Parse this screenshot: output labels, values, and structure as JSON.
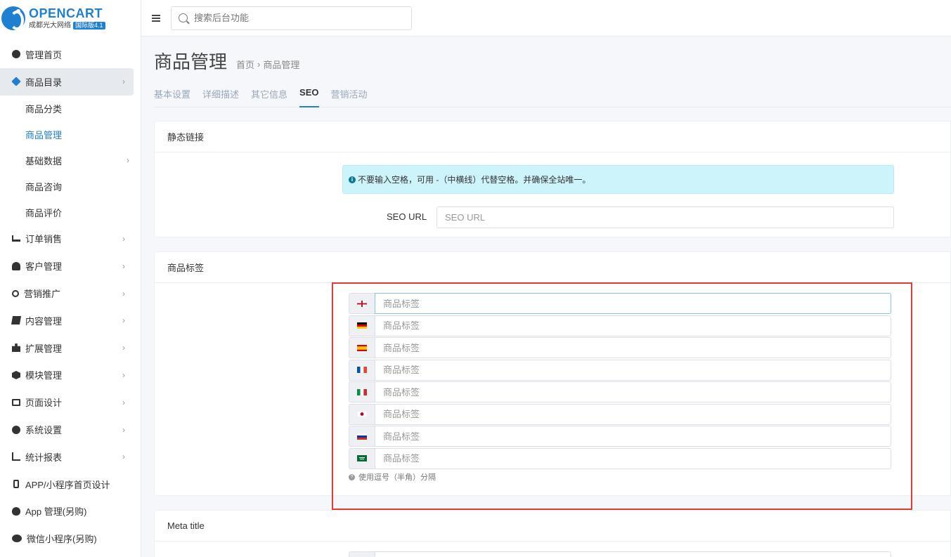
{
  "brand": {
    "title": "OPENCART",
    "subtitle": "成都光大网络",
    "badge": "国际版4.1"
  },
  "search": {
    "placeholder": "搜索后台功能"
  },
  "sidebar": {
    "items": [
      {
        "label": "管理首页",
        "icon": "dashboard-icon"
      },
      {
        "label": "商品目录",
        "icon": "tags-icon",
        "active": true
      },
      {
        "label": "订单销售",
        "icon": "cart-icon"
      },
      {
        "label": "客户管理",
        "icon": "user-icon"
      },
      {
        "label": "营销推广",
        "icon": "share-icon"
      },
      {
        "label": "内容管理",
        "icon": "book-icon"
      },
      {
        "label": "扩展管理",
        "icon": "puzzle-icon"
      },
      {
        "label": "模块管理",
        "icon": "cube-icon"
      },
      {
        "label": "页面设计",
        "icon": "monitor-icon"
      },
      {
        "label": "系统设置",
        "icon": "gear-icon"
      },
      {
        "label": "统计报表",
        "icon": "bar-chart-icon"
      },
      {
        "label": "APP/小程序首页设计",
        "icon": "mobile-icon"
      },
      {
        "label": "App 管理(另购)",
        "icon": "apple-icon"
      },
      {
        "label": "微信小程序(另购)",
        "icon": "wechat-icon"
      }
    ],
    "catalog_sub": [
      {
        "label": "商品分类"
      },
      {
        "label": "商品管理",
        "current": true
      },
      {
        "label": "基础数据",
        "has_children": true
      },
      {
        "label": "商品咨询"
      },
      {
        "label": "商品评价"
      }
    ]
  },
  "page": {
    "title": "商品管理",
    "breadcrumb": [
      "首页",
      "商品管理"
    ],
    "breadcrumb_sep": "›"
  },
  "tabs": [
    {
      "label": "基本设置"
    },
    {
      "label": "详细描述"
    },
    {
      "label": "其它信息"
    },
    {
      "label": "SEO",
      "active": true
    },
    {
      "label": "营销活动"
    }
  ],
  "seo_card": {
    "title": "静态链接",
    "alert": "不要输入空格，可用 -（中横线）代替空格。并确保全站唯一。",
    "seo_url_label": "SEO URL",
    "seo_url_placeholder": "SEO URL"
  },
  "tags_card": {
    "title": "商品标签",
    "placeholder": "商品标签",
    "languages": [
      "en-gb",
      "de-de",
      "es-es",
      "fr-fr",
      "it-it",
      "ja-jp",
      "ru-ru",
      "ar-sa"
    ],
    "help": "使用逗号（半角）分隔"
  },
  "meta_card": {
    "title": "Meta title"
  },
  "colors": {
    "accent": "#1f7fd1",
    "alert_bg": "#cdf3fb",
    "highlight": "#e53935"
  }
}
